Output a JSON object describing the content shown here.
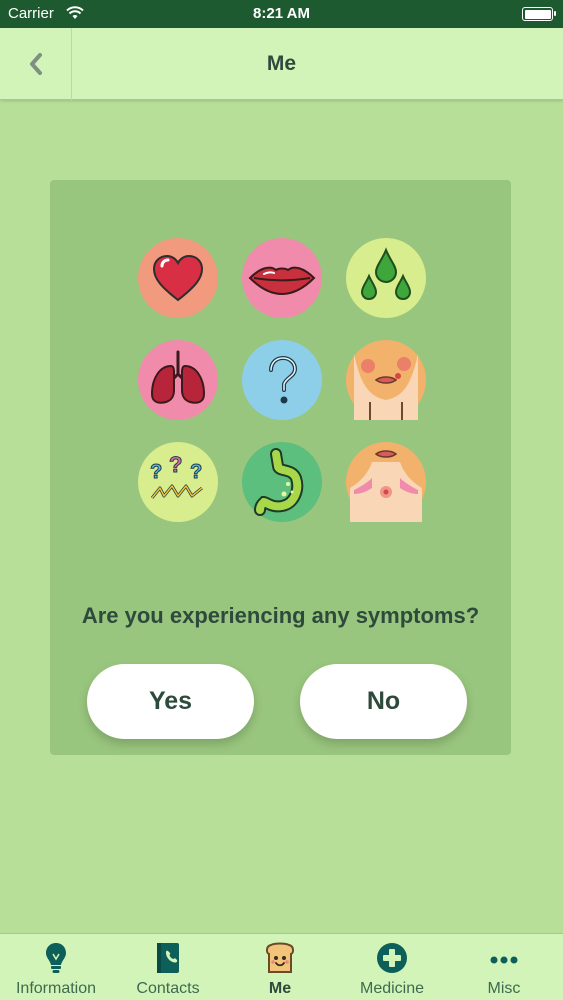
{
  "status_bar": {
    "carrier": "Carrier",
    "time": "8:21 AM"
  },
  "nav": {
    "title": "Me",
    "back_icon": "chevron-left-icon"
  },
  "symptom_icons": [
    {
      "name": "heart-icon",
      "bg": "#f19a7d"
    },
    {
      "name": "lips-icon",
      "bg": "#f08bab"
    },
    {
      "name": "drops-icon",
      "bg": "#d8ed8e"
    },
    {
      "name": "lungs-icon",
      "bg": "#f08bab"
    },
    {
      "name": "question-mark-icon",
      "bg": "#8dcfe9"
    },
    {
      "name": "face-rash-icon",
      "bg": "#f2b26b"
    },
    {
      "name": "confusion-icon",
      "bg": "#d8ed8e"
    },
    {
      "name": "stomach-icon",
      "bg": "#5dbf7d"
    },
    {
      "name": "neck-rash-icon",
      "bg": "#f2b26b"
    }
  ],
  "prompt": {
    "question": "Are you experiencing any symptoms?",
    "yes_label": "Yes",
    "no_label": "No"
  },
  "tabs": [
    {
      "label": "Information",
      "icon": "lightbulb-icon"
    },
    {
      "label": "Contacts",
      "icon": "contacts-book-icon"
    },
    {
      "label": "Me",
      "icon": "toast-face-icon",
      "active": true
    },
    {
      "label": "Medicine",
      "icon": "medical-cross-icon"
    },
    {
      "label": "Misc",
      "icon": "more-dots-icon"
    }
  ]
}
